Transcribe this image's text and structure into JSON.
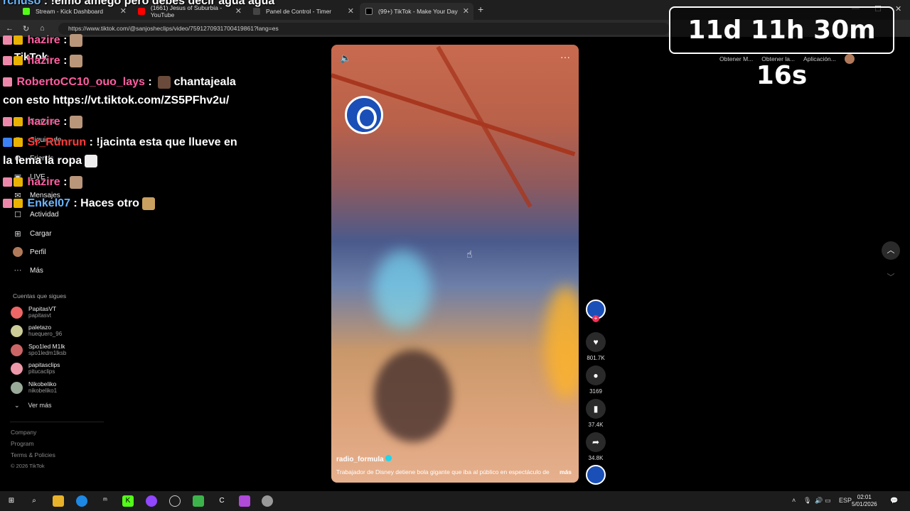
{
  "browser": {
    "tabs": [
      {
        "label": "Stream - Kick Dashboard",
        "fav_color": "#53fc18"
      },
      {
        "label": "(1661) Jesus of Suburbia - YouTube",
        "fav_color": "#ff0000"
      },
      {
        "label": "Panel de Control - Timer",
        "fav_color": "#444444"
      },
      {
        "label": "(99+) TikTok - Make Your Day",
        "fav_color": "#000000"
      }
    ],
    "url": "https://www.tiktok.com/@sanjosheclips/video/7591270931700419861?lang=es"
  },
  "sidebar": {
    "logo": "TikTok",
    "items": [
      {
        "label": "Explorar",
        "icon": "compass-icon"
      },
      {
        "label": "Siguiendo",
        "icon": "following-icon"
      },
      {
        "label": "Friends",
        "icon": "friends-icon"
      },
      {
        "label": "LIVE",
        "icon": "live-icon"
      },
      {
        "label": "Mensajes",
        "icon": "messages-icon",
        "badge": "99+"
      },
      {
        "label": "Actividad",
        "icon": "activity-icon"
      },
      {
        "label": "Cargar",
        "icon": "upload-icon"
      },
      {
        "label": "Perfil",
        "icon": "profile-icon"
      },
      {
        "label": "Más",
        "icon": "more-icon"
      }
    ],
    "following_header": "Cuentas que sigues",
    "accounts": [
      {
        "name": "PapitasVT",
        "handle": "papitasvt"
      },
      {
        "name": "paletazo",
        "handle": "huequero_96"
      },
      {
        "name": "Spo1led M1lk",
        "handle": "spo1ledm1lksb"
      },
      {
        "name": "papitasclips",
        "handle": "pitucaclips"
      },
      {
        "name": "Nikobeliko",
        "handle": "nikobeliko1"
      }
    ],
    "see_more": "Ver más",
    "footer": [
      "Company",
      "Program",
      "Terms & Policies",
      "© 2026 TikTok"
    ]
  },
  "chat": [
    {
      "user": "rchuso",
      "text": "!elmo amego pero debes decir agua agua",
      "color": "#6bb6ff"
    },
    {
      "user": "hazire",
      "text": "",
      "color": "#ff5ea0"
    },
    {
      "user": "hazire",
      "text": "",
      "color": "#ff5ea0"
    },
    {
      "user": "RobertoCC10_ouo_lays",
      "text": "chantajeala con esto https://vt.tiktok.com/ZS5PFhv2u/",
      "color": "#ff5ea0"
    },
    {
      "user": "hazire",
      "text": "",
      "color": "#ff5ea0"
    },
    {
      "user": "Sr_Runrun",
      "text": "!jacinta esta que llueve en la lema la ropa",
      "color": "#ff3b3b"
    },
    {
      "user": "hazire",
      "text": "",
      "color": "#ff5ea0"
    },
    {
      "user": "Enkel07",
      "text": "Haces otro",
      "color": "#6bb6ff"
    }
  ],
  "timer": "11d 11h 30m 16s",
  "top_actions": [
    "Obtener M...",
    "Obtener la...",
    "Aplicación..."
  ],
  "video": {
    "author": "radio_formula",
    "description": "Trabajador de Disney detiene bola gigante que iba al público en espectáculo de",
    "more": "más"
  },
  "actions": {
    "likes": "801.7K",
    "comments": "3169",
    "saves": "37.4K",
    "shares": "34.8K"
  },
  "taskbar": {
    "lang": "ESP",
    "time": "02:01",
    "date": "5/01/2026"
  }
}
